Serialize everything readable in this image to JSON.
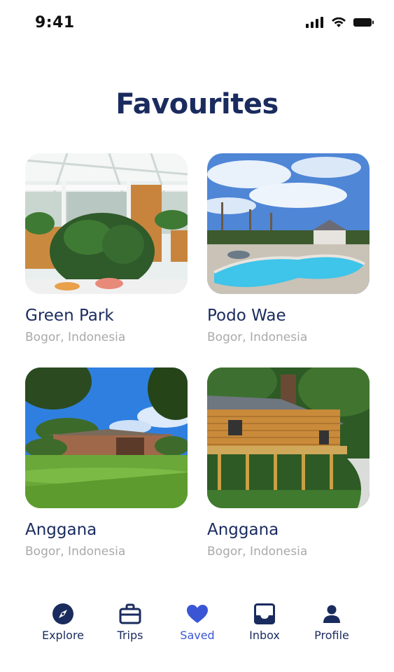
{
  "status_bar": {
    "time": "9:41"
  },
  "page": {
    "title": "Favourites"
  },
  "favourites": [
    {
      "name": "Green Park",
      "location": "Bogor, Indonesia"
    },
    {
      "name": "Podo Wae",
      "location": "Bogor, Indonesia"
    },
    {
      "name": "Anggana",
      "location": "Bogor, Indonesia"
    },
    {
      "name": "Anggana",
      "location": "Bogor, Indonesia"
    }
  ],
  "tabs": [
    {
      "label": "Explore",
      "icon": "compass-icon"
    },
    {
      "label": "Trips",
      "icon": "briefcase-icon"
    },
    {
      "label": "Saved",
      "icon": "heart-icon",
      "active": true
    },
    {
      "label": "Inbox",
      "icon": "inbox-icon"
    },
    {
      "label": "Profile",
      "icon": "person-icon"
    }
  ],
  "colors": {
    "primary": "#1a2b5e",
    "accent": "#3a56d4",
    "muted": "#a9a9a9"
  }
}
